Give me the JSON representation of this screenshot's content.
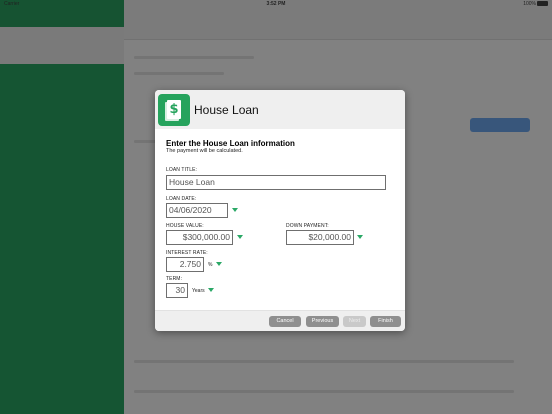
{
  "status_bar": {
    "carrier": "Carrier",
    "time": "3:52 PM",
    "battery": "100%"
  },
  "dialog": {
    "title": "House Loan",
    "heading": "Enter the House Loan information",
    "subheading": "The payment will be calculated.",
    "fields": {
      "loan_title": {
        "label": "LOAN TITLE:",
        "value": "House Loan"
      },
      "loan_date": {
        "label": "LOAN DATE:",
        "value": "04/06/2020"
      },
      "house_value": {
        "label": "HOUSE VALUE:",
        "value": "$300,000.00"
      },
      "down_payment": {
        "label": "DOWN PAYMENT:",
        "value": "$20,000.00"
      },
      "interest_rate": {
        "label": "INTEREST RATE:",
        "value": "2.750",
        "unit": "%"
      },
      "term": {
        "label": "TERM:",
        "value": "30",
        "unit": "Years"
      }
    },
    "buttons": {
      "cancel": "Cancel",
      "previous": "Previous",
      "next": "Next",
      "finish": "Finish"
    }
  },
  "colors": {
    "accent_green": "#26a35d",
    "button_gray": "#8f8f8f"
  },
  "icons": {
    "app_icon": "dollar-document-icon",
    "dropdown": "chevron-down-icon"
  }
}
